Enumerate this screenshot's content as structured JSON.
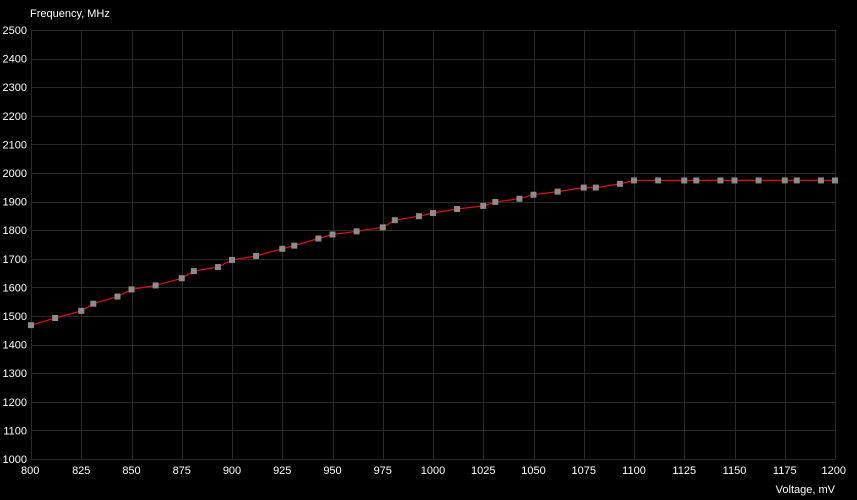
{
  "chart_data": {
    "type": "line",
    "title": "",
    "xlabel": "Voltage, mV",
    "ylabel": "Frequency, MHz",
    "xlim": [
      800,
      1200
    ],
    "ylim": [
      1000,
      2500
    ],
    "x_ticks": [
      800,
      825,
      850,
      875,
      900,
      925,
      950,
      975,
      1000,
      1025,
      1050,
      1075,
      1100,
      1125,
      1150,
      1175,
      1200
    ],
    "y_ticks": [
      1000,
      1100,
      1200,
      1300,
      1400,
      1500,
      1600,
      1700,
      1800,
      1900,
      2000,
      2100,
      2200,
      2300,
      2400,
      2500
    ],
    "grid": true,
    "background": "#000000",
    "grid_color": "#2a2a2a",
    "line_color": "#e01010",
    "marker_color": "#8c8c8c",
    "series": [
      {
        "x": [
          800,
          812,
          825,
          831,
          843,
          850,
          862,
          875,
          881,
          893,
          900,
          912,
          925,
          931,
          943,
          950,
          962,
          975,
          981,
          993,
          1000,
          1012,
          1025,
          1031,
          1043,
          1050,
          1062,
          1075,
          1081,
          1093,
          1100,
          1112,
          1125,
          1131,
          1143,
          1150,
          1162,
          1175,
          1181,
          1193,
          1200
        ],
        "y": [
          1468,
          1493,
          1518,
          1543,
          1568,
          1593,
          1607,
          1632,
          1657,
          1671,
          1696,
          1710,
          1735,
          1746,
          1771,
          1785,
          1796,
          1810,
          1835,
          1849,
          1860,
          1874,
          1885,
          1899,
          1910,
          1924,
          1935,
          1949,
          1949,
          1962,
          1974,
          1974,
          1974,
          1974,
          1974,
          1974,
          1974,
          1974,
          1974,
          1974,
          1974
        ]
      }
    ]
  }
}
